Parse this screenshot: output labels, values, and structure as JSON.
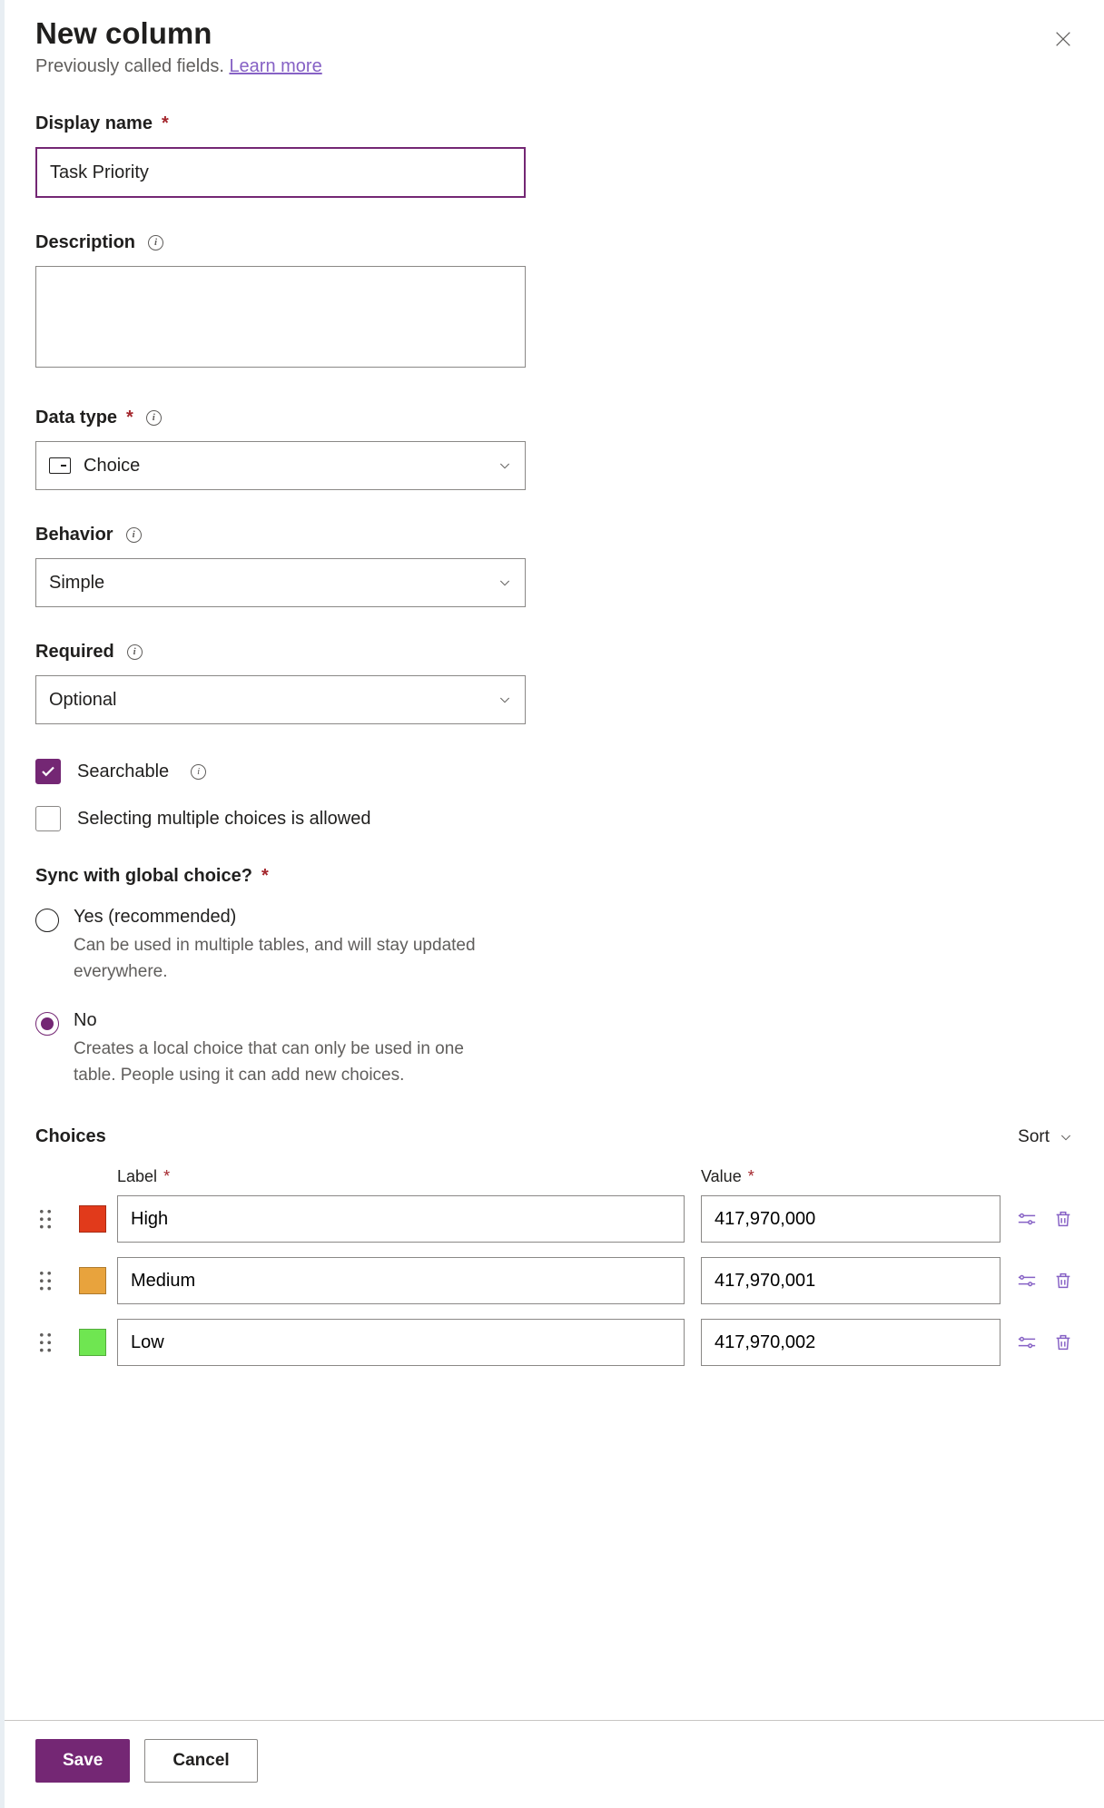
{
  "header": {
    "title": "New column",
    "subtitle_text": "Previously called fields. ",
    "learn_more": "Learn more"
  },
  "fields": {
    "display_name": {
      "label": "Display name",
      "value": "Task Priority"
    },
    "description": {
      "label": "Description",
      "value": ""
    },
    "data_type": {
      "label": "Data type",
      "selected": "Choice"
    },
    "behavior": {
      "label": "Behavior",
      "selected": "Simple"
    },
    "required": {
      "label": "Required",
      "selected": "Optional"
    },
    "searchable": {
      "label": "Searchable",
      "checked": true
    },
    "multi_choice": {
      "label": "Selecting multiple choices is allowed",
      "checked": false
    }
  },
  "sync": {
    "label": "Sync with global choice?",
    "options": [
      {
        "label": "Yes (recommended)",
        "desc": "Can be used in multiple tables, and will stay updated everywhere.",
        "selected": false
      },
      {
        "label": "No",
        "desc": "Creates a local choice that can only be used in one table. People using it can add new choices.",
        "selected": true
      }
    ]
  },
  "choices": {
    "header": "Choices",
    "sort_label": "Sort",
    "col_label": "Label",
    "col_value": "Value",
    "rows": [
      {
        "color": "#e13a1b",
        "label": "High",
        "value": "417,970,000"
      },
      {
        "color": "#e8a33d",
        "label": "Medium",
        "value": "417,970,001"
      },
      {
        "color": "#6fe651",
        "label": "Low",
        "value": "417,970,002"
      }
    ]
  },
  "footer": {
    "save": "Save",
    "cancel": "Cancel"
  }
}
